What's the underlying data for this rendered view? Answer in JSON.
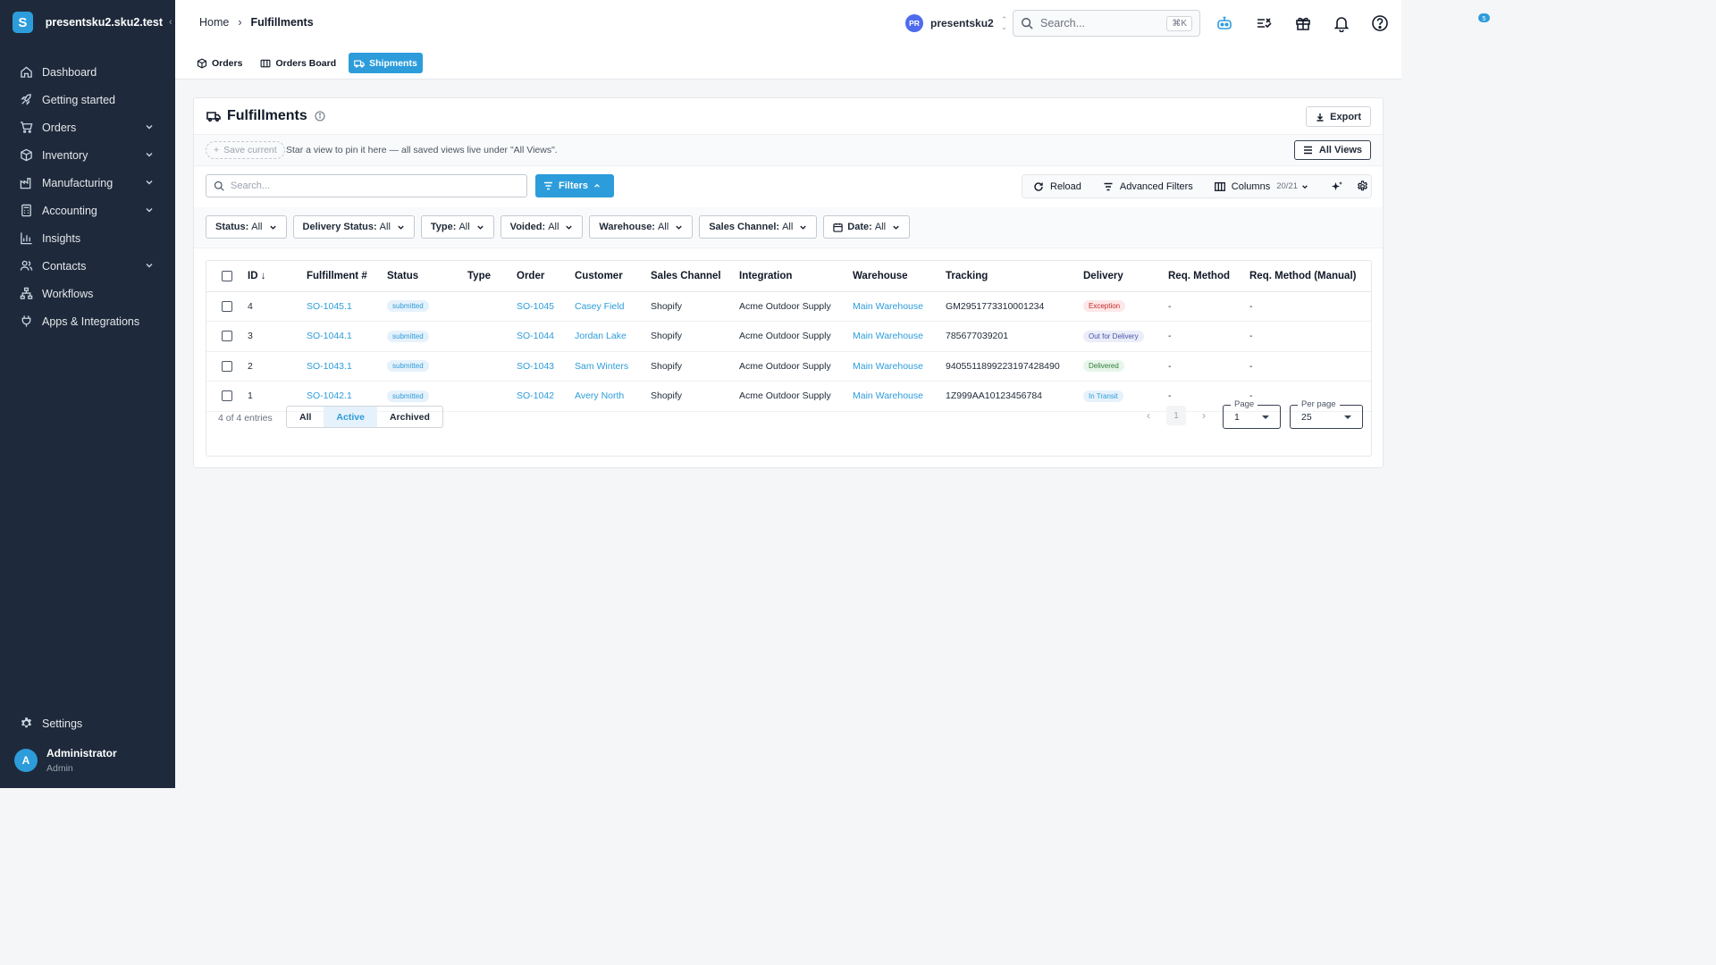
{
  "app": {
    "workspace_name": "presentsku2.sku2.test",
    "logo_letter": "S"
  },
  "sidebar": {
    "items": [
      {
        "label": "Dashboard",
        "icon": "home-icon"
      },
      {
        "label": "Getting started",
        "icon": "rocket-icon"
      },
      {
        "label": "Orders",
        "icon": "cart-icon",
        "expandable": true
      },
      {
        "label": "Inventory",
        "icon": "box-icon",
        "expandable": true
      },
      {
        "label": "Manufacturing",
        "icon": "factory-icon",
        "expandable": true
      },
      {
        "label": "Accounting",
        "icon": "calculator-icon",
        "expandable": true
      },
      {
        "label": "Insights",
        "icon": "bar-chart-icon"
      },
      {
        "label": "Contacts",
        "icon": "people-icon",
        "expandable": true
      },
      {
        "label": "Workflows",
        "icon": "workflow-icon"
      },
      {
        "label": "Apps & Integrations",
        "icon": "plug-icon"
      }
    ],
    "settings_label": "Settings",
    "user": {
      "initial": "A",
      "name": "Administrator",
      "role": "Admin"
    }
  },
  "header": {
    "breadcrumb": [
      "Home",
      "Fulfillments"
    ],
    "tenant": {
      "initials": "PR",
      "name": "presentsku2"
    },
    "search": {
      "placeholder": "Search...",
      "shortcut": "⌘K"
    },
    "gift_badge": "5"
  },
  "tabs": [
    {
      "label": "Orders",
      "active": false
    },
    {
      "label": "Orders Board",
      "active": false
    },
    {
      "label": "Shipments",
      "active": true
    }
  ],
  "page": {
    "title": "Fulfillments",
    "export_label": "Export",
    "save_current_label": "Save current",
    "views_hint": "Star a view to pin it here — all saved views live under \"All Views\".",
    "all_views_label": "All Views",
    "search_placeholder": "Search...",
    "filters_label": "Filters",
    "reload_label": "Reload",
    "advanced_filters_label": "Advanced Filters",
    "columns_label": "Columns",
    "columns_count": "20/21"
  },
  "filters": [
    {
      "key": "Status:",
      "value": "All"
    },
    {
      "key": "Delivery Status:",
      "value": "All"
    },
    {
      "key": "Type:",
      "value": "All"
    },
    {
      "key": "Voided:",
      "value": "All"
    },
    {
      "key": "Warehouse:",
      "value": "All"
    },
    {
      "key": "Sales Channel:",
      "value": "All"
    },
    {
      "key": "Date:",
      "value": "All"
    }
  ],
  "table": {
    "columns": [
      "ID",
      "Fulfillment #",
      "Status",
      "Type",
      "Order",
      "Customer",
      "Sales Channel",
      "Integration",
      "Warehouse",
      "Tracking",
      "Delivery",
      "Req. Method",
      "Req. Method (Manual)"
    ],
    "rows": [
      {
        "id": "4",
        "fulfillment": "SO-1045.1",
        "status": "submitted",
        "type": "",
        "order": "SO-1045",
        "customer": "Casey Field",
        "channel": "Shopify",
        "integration": "Acme Outdoor Supply",
        "warehouse": "Main Warehouse",
        "tracking": "GM2951773310001234",
        "delivery": "Exception",
        "req_method": "-",
        "req_manual": "-"
      },
      {
        "id": "3",
        "fulfillment": "SO-1044.1",
        "status": "submitted",
        "type": "",
        "order": "SO-1044",
        "customer": "Jordan Lake",
        "channel": "Shopify",
        "integration": "Acme Outdoor Supply",
        "warehouse": "Main Warehouse",
        "tracking": "785677039201",
        "delivery": "Out for Delivery",
        "req_method": "-",
        "req_manual": "-"
      },
      {
        "id": "2",
        "fulfillment": "SO-1043.1",
        "status": "submitted",
        "type": "",
        "order": "SO-1043",
        "customer": "Sam Winters",
        "channel": "Shopify",
        "integration": "Acme Outdoor Supply",
        "warehouse": "Main Warehouse",
        "tracking": "9405511899223197428490",
        "delivery": "Delivered",
        "req_method": "-",
        "req_manual": "-"
      },
      {
        "id": "1",
        "fulfillment": "SO-1042.1",
        "status": "submitted",
        "type": "",
        "order": "SO-1042",
        "customer": "Avery North",
        "channel": "Shopify",
        "integration": "Acme Outdoor Supply",
        "warehouse": "Main Warehouse",
        "tracking": "1Z999AA10123456784",
        "delivery": "In Transit",
        "req_method": "-",
        "req_manual": "-"
      }
    ],
    "entries_text": "4 of 4 entries",
    "segments": [
      "All",
      "Active",
      "Archived"
    ],
    "active_segment": "Active",
    "current_page": "1",
    "page_label": "Page",
    "page_value": "1",
    "per_page_label": "Per page",
    "per_page_value": "25"
  },
  "colors": {
    "accent": "#2d9cdb",
    "sidebar_bg": "#1e2a3b"
  }
}
